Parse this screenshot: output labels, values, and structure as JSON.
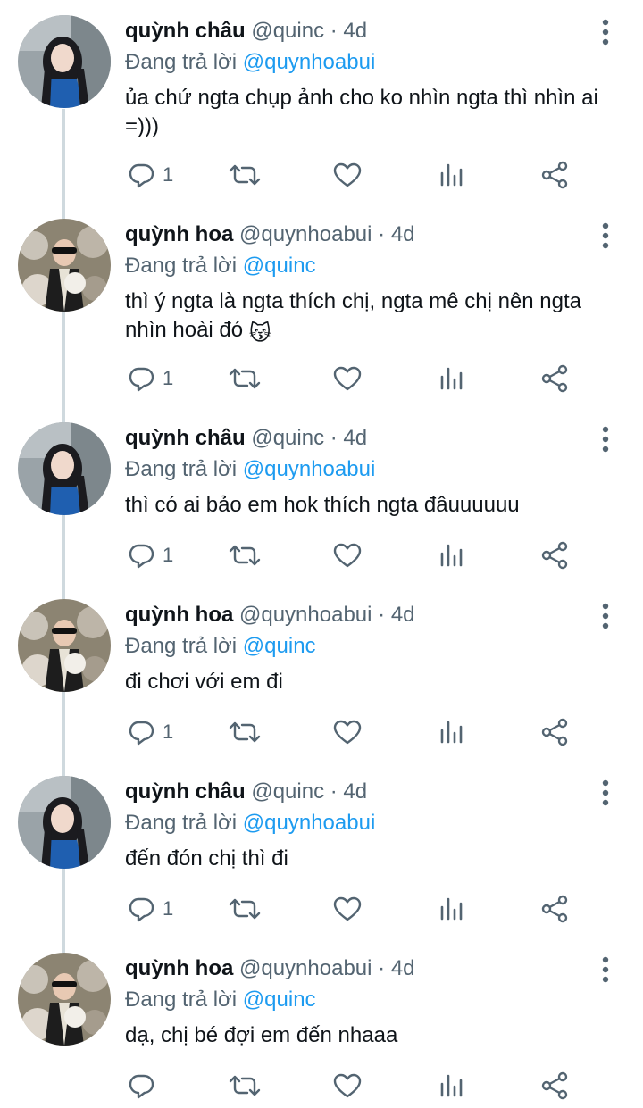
{
  "thread": {
    "replying_prefix": "Đang trả lời",
    "tweets": [
      {
        "name": "quỳnh châu",
        "handle": "@quinc",
        "time": "· 4d",
        "reply_to": "@quynhoabui",
        "text": "ủa chứ ngta chụp ảnh cho ko nhìn ngta thì nhìn ai =)))",
        "reply_count": "1",
        "avatar_icon": "avatar-photo-chau"
      },
      {
        "name": "quỳnh hoa",
        "handle": "@quynhoabui",
        "time": "· 4d",
        "reply_to": "@quinc",
        "text": "thì ý ngta là ngta thích chị, ngta mê chị nên ngta nhìn hoài đó",
        "emoji": "😽",
        "reply_count": "1",
        "avatar_icon": "avatar-photo-hoa"
      },
      {
        "name": "quỳnh châu",
        "handle": "@quinc",
        "time": "· 4d",
        "reply_to": "@quynhoabui",
        "text": "thì có ai bảo em hok thích ngta đâuuuuuu",
        "reply_count": "1",
        "avatar_icon": "avatar-photo-chau"
      },
      {
        "name": "quỳnh hoa",
        "handle": "@quynhoabui",
        "time": "· 4d",
        "reply_to": "@quinc",
        "text": "đi chơi với em đi",
        "reply_count": "1",
        "avatar_icon": "avatar-photo-hoa"
      },
      {
        "name": "quỳnh châu",
        "handle": "@quinc",
        "time": "· 4d",
        "reply_to": "@quynhoabui",
        "text": "đến đón chị thì đi",
        "reply_count": "1",
        "avatar_icon": "avatar-photo-chau"
      },
      {
        "name": "quỳnh hoa",
        "handle": "@quynhoabui",
        "time": "· 4d",
        "reply_to": "@quinc",
        "text": "dạ, chị bé đợi em đến nhaaa",
        "reply_count": "",
        "avatar_icon": "avatar-photo-hoa"
      }
    ]
  },
  "icons": {
    "reply": "reply-icon",
    "retweet": "retweet-icon",
    "like": "like-icon",
    "views": "views-icon",
    "share": "share-icon",
    "more": "more-vertical-icon"
  },
  "colors": {
    "text": "#0f1419",
    "secondary": "#536471",
    "mention": "#1d9bf0",
    "thread_line": "#cfd9de"
  }
}
